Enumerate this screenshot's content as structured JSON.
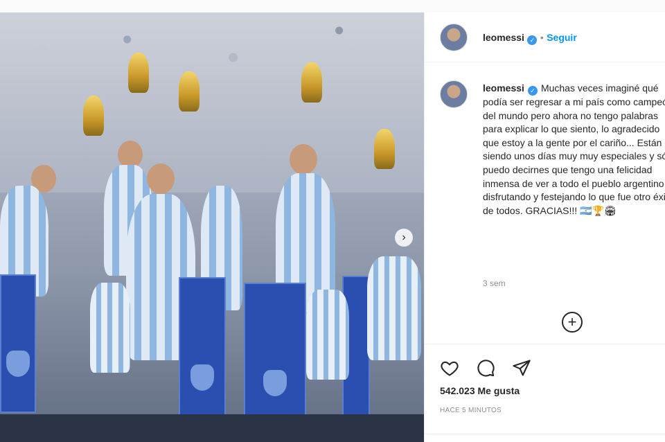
{
  "post": {
    "username": "leomessi",
    "verified_mark": "✓",
    "separator": "•",
    "follow_label": "Seguir",
    "caption": "Muchas veces imaginé qué podía ser regresar a mi país como campeón del mundo pero ahora no tengo palabras para explicar lo que siento, lo agradecido que estoy a la gente por el cariño... Están siendo unos días muy muy especiales y sólo puedo decirnes que tengo una felicidad inmensa de ver a todo el pueblo argentino disfrutando y festejando lo que fue otro éxito de todos. GRACIAS!!! 🇦🇷🏆🏟",
    "time": "3 sem",
    "likes": "542.023 Me gusta",
    "time_ago": "HACE 5 MINUTOS"
  },
  "icons": {
    "like": "heart-icon",
    "comment": "comment-icon",
    "share": "send-icon",
    "more_comments": "plus-circle-icon",
    "next": "chevron-right-icon"
  },
  "colors": {
    "follow": "#0095f6",
    "verified": "#3897f0",
    "banner": "#2a4fb0"
  }
}
